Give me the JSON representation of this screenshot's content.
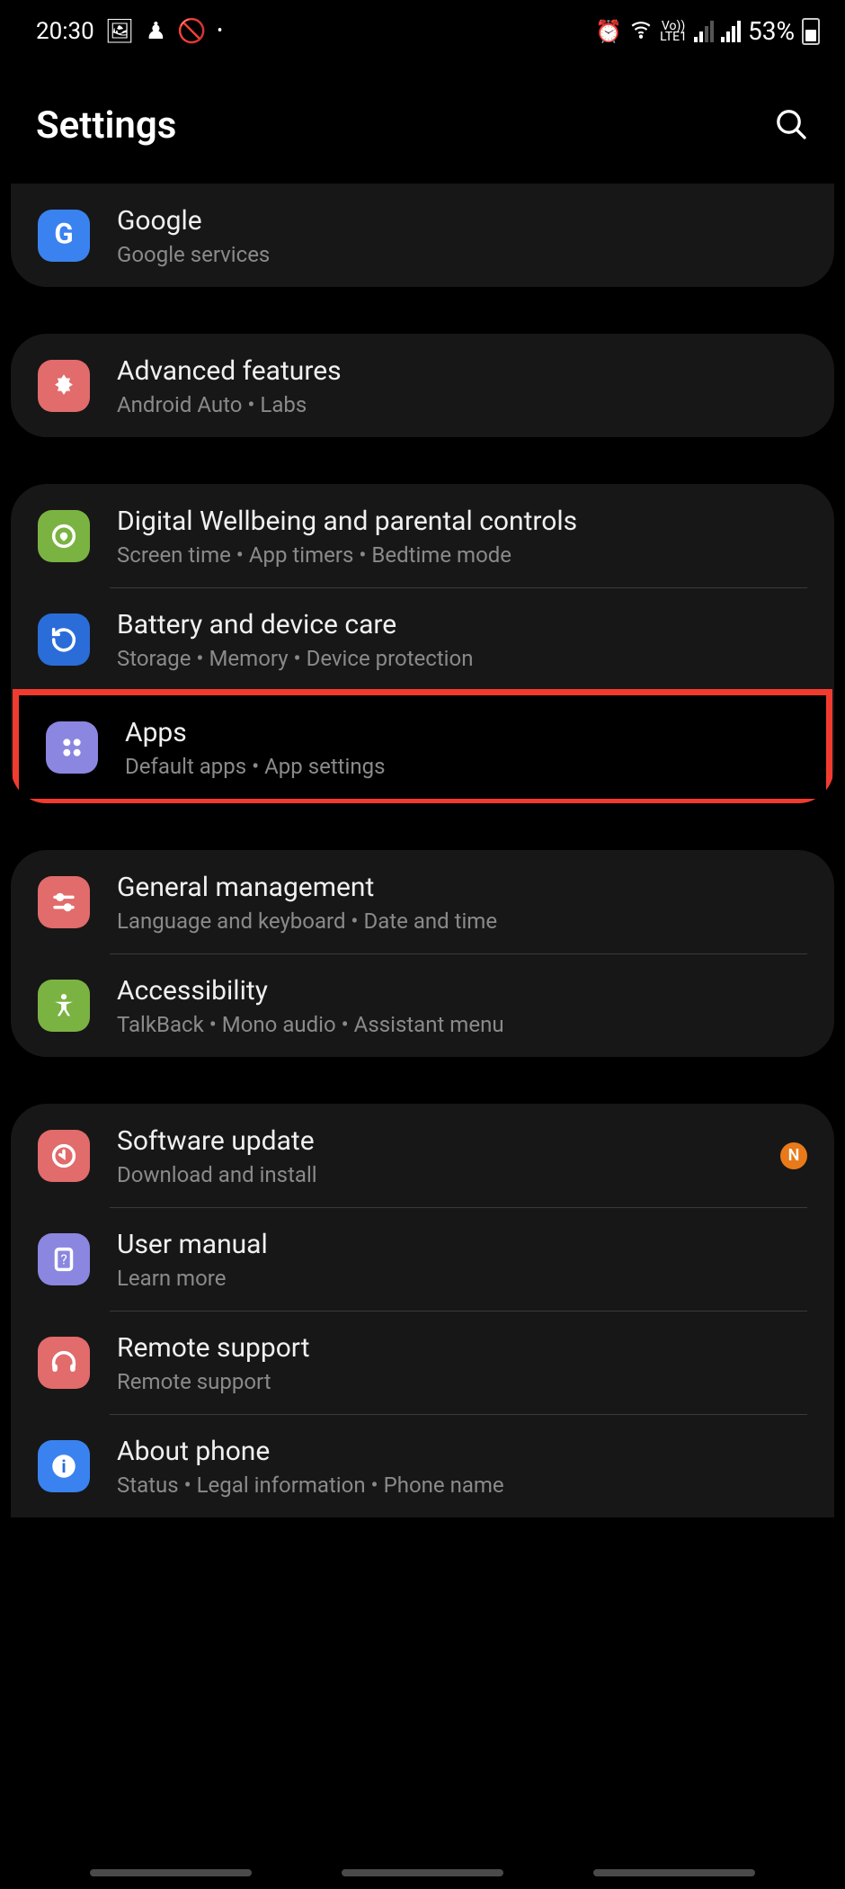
{
  "statusbar": {
    "time": "20:30",
    "lte_label": "Vo))\nLTE1",
    "battery_pct": "53%"
  },
  "header": {
    "title": "Settings"
  },
  "badge_label": "N",
  "items": {
    "google": {
      "title": "Google",
      "sub": "Google services"
    },
    "advanced": {
      "title": "Advanced features",
      "sub": "Android Auto  •  Labs"
    },
    "wellbeing": {
      "title": "Digital Wellbeing and parental controls",
      "sub": "Screen time  •  App timers  •  Bedtime mode"
    },
    "battery": {
      "title": "Battery and device care",
      "sub": "Storage  •  Memory  •  Device protection"
    },
    "apps": {
      "title": "Apps",
      "sub": "Default apps  •  App settings"
    },
    "general": {
      "title": "General management",
      "sub": "Language and keyboard  •  Date and time"
    },
    "accessibility": {
      "title": "Accessibility",
      "sub": "TalkBack  •  Mono audio  •  Assistant menu"
    },
    "update": {
      "title": "Software update",
      "sub": "Download and install"
    },
    "manual": {
      "title": "User manual",
      "sub": "Learn more"
    },
    "remote": {
      "title": "Remote support",
      "sub": "Remote support"
    },
    "about": {
      "title": "About phone",
      "sub": "Status  •  Legal information  •  Phone name"
    }
  }
}
